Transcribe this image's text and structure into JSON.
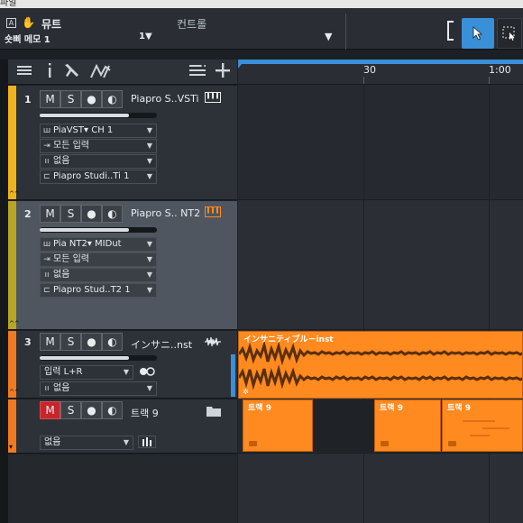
{
  "header": {
    "track_title": "뮤트",
    "sub_label": "숏삐 메모 1",
    "control_label": "컨트롤",
    "control_value": "1▼",
    "dropdown_arrow": "▼"
  },
  "toolbar": {
    "icons": [
      "list-icon",
      "info-icon",
      "wrench-icon",
      "automation-icon",
      "track-list-icon",
      "add-track-icon"
    ]
  },
  "ruler": {
    "ticks": [
      "30",
      "1:00"
    ]
  },
  "tracks": [
    {
      "number": "1",
      "name": "Piapro S..VSTi",
      "color": "#f0b31c",
      "buttons": [
        "M",
        "S",
        "●",
        "◐"
      ],
      "fields": [
        {
          "icon": "ш",
          "label": "PiaVST▾  CH 1"
        },
        {
          "icon": "⇥",
          "label": "모든 입력"
        },
        {
          "icon": "ıı",
          "label": "없음"
        },
        {
          "icon": "⊏",
          "label": "Piapro Studi..Ti 1"
        }
      ]
    },
    {
      "number": "2",
      "name": "Piapro S.. NT2",
      "color": "#b8a520",
      "buttons": [
        "M",
        "S",
        "●",
        "◐"
      ],
      "fields": [
        {
          "icon": "ш",
          "label": "Pia NT2▾  MIDut"
        },
        {
          "icon": "⇥",
          "label": "모든 입력"
        },
        {
          "icon": "ıı",
          "label": "없음"
        },
        {
          "icon": "⊏",
          "label": "Piapro Stud..T2 1"
        }
      ]
    },
    {
      "number": "3",
      "name": "インサニ..nst",
      "color": "#f27a1e",
      "buttons": [
        "M",
        "S",
        "●",
        "◐"
      ],
      "fields": [
        {
          "icon": "",
          "label": "입력 L+R"
        },
        {
          "icon": "ıı",
          "label": "없음"
        }
      ]
    },
    {
      "number": "",
      "name": "트랙 9",
      "color": "#f27a1e",
      "buttons": [
        "M",
        "S",
        "●",
        "◐"
      ],
      "fields": [
        {
          "icon": "",
          "label": "없음"
        }
      ]
    }
  ],
  "clips": {
    "audio_label": "インサニティブル－inst",
    "midi_label": "트랙 9"
  },
  "colors": {
    "accent_blue": "#3a8fd9",
    "clip_orange": "#ff8a1f",
    "mute_red": "#c7252c"
  }
}
